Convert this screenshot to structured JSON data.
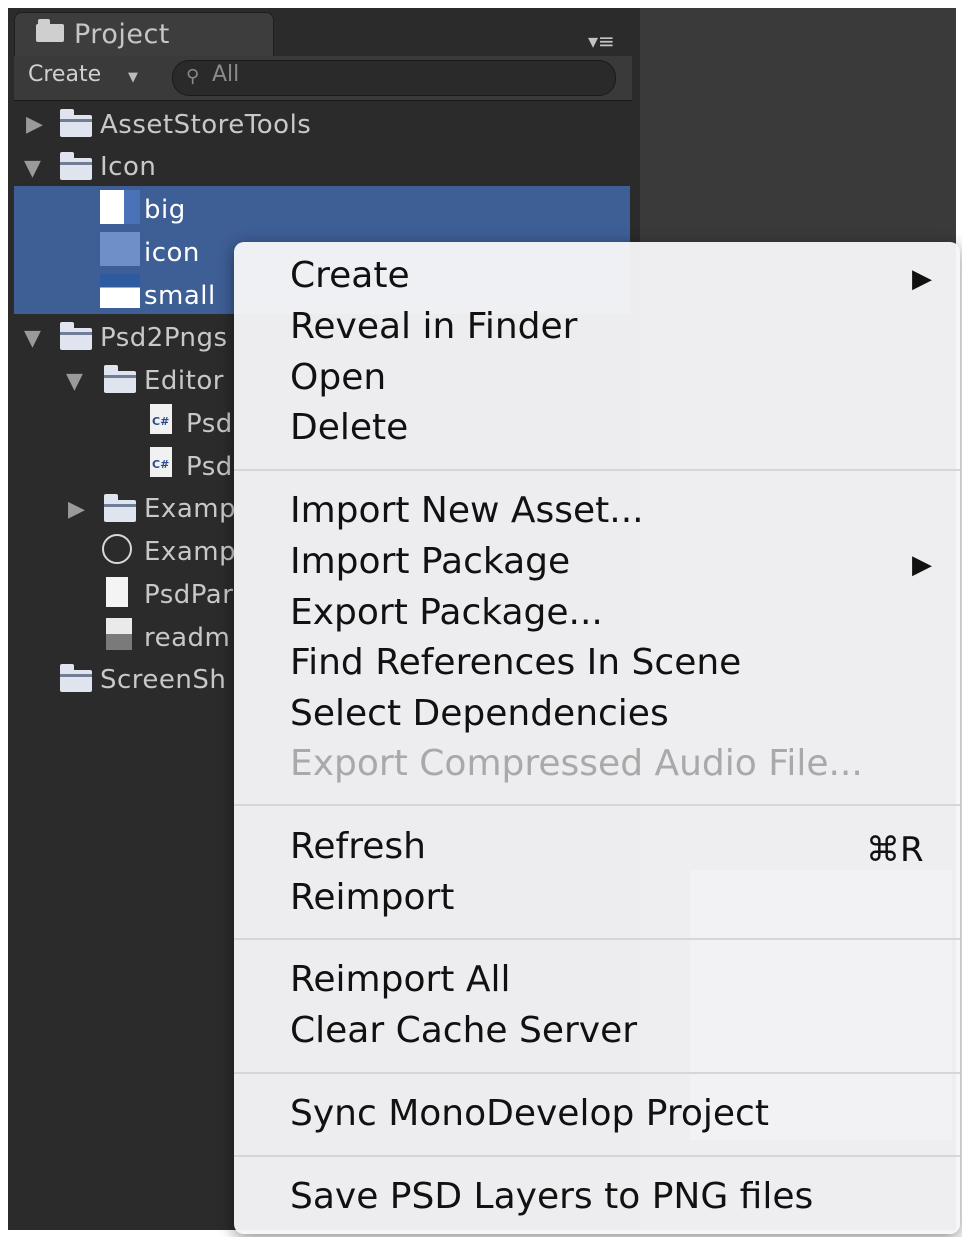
{
  "panel": {
    "tab_title": "Project",
    "create_label": "Create",
    "search_placeholder": "All"
  },
  "tree": [
    {
      "label": "AssetStoreTools",
      "kind": "folder",
      "expanded": false
    },
    {
      "label": "Icon",
      "kind": "folder",
      "expanded": true
    },
    {
      "label": "big",
      "kind": "image",
      "selected": true
    },
    {
      "label": "icon",
      "kind": "image",
      "selected": true
    },
    {
      "label": "small",
      "kind": "image",
      "selected": true
    },
    {
      "label": "Psd2Pngs",
      "kind": "folder",
      "expanded": true
    },
    {
      "label": "Editor",
      "kind": "folder",
      "expanded": true
    },
    {
      "label": "Psd",
      "kind": "script"
    },
    {
      "label": "Psd",
      "kind": "script"
    },
    {
      "label": "Examp",
      "kind": "folder",
      "expanded": false
    },
    {
      "label": "Examp",
      "kind": "scene"
    },
    {
      "label": "PsdPar",
      "kind": "file"
    },
    {
      "label": "readm",
      "kind": "image"
    },
    {
      "label": "ScreenSh",
      "kind": "folder"
    }
  ],
  "context_menu": {
    "groups": [
      [
        {
          "label": "Create",
          "submenu": true
        },
        {
          "label": "Reveal in Finder"
        },
        {
          "label": "Open"
        },
        {
          "label": "Delete"
        }
      ],
      [
        {
          "label": "Import New Asset..."
        },
        {
          "label": "Import Package",
          "submenu": true
        },
        {
          "label": "Export Package..."
        },
        {
          "label": "Find References In Scene"
        },
        {
          "label": "Select Dependencies"
        },
        {
          "label": "Export Compressed Audio File...",
          "disabled": true
        }
      ],
      [
        {
          "label": "Refresh",
          "shortcut": "⌘R"
        },
        {
          "label": "Reimport"
        }
      ],
      [
        {
          "label": "Reimport All"
        },
        {
          "label": "Clear Cache Server"
        }
      ],
      [
        {
          "label": "Sync MonoDevelop Project"
        }
      ],
      [
        {
          "label": "Save PSD Layers to PNG files"
        }
      ]
    ]
  },
  "icons": {
    "submenu_arrow": "▶",
    "tab_menu": "▾≡",
    "search": "⚲"
  },
  "colors": {
    "selection": "#3e5e96",
    "panel_bg": "#2b2b2b",
    "menu_bg": "#f6f6f8"
  }
}
